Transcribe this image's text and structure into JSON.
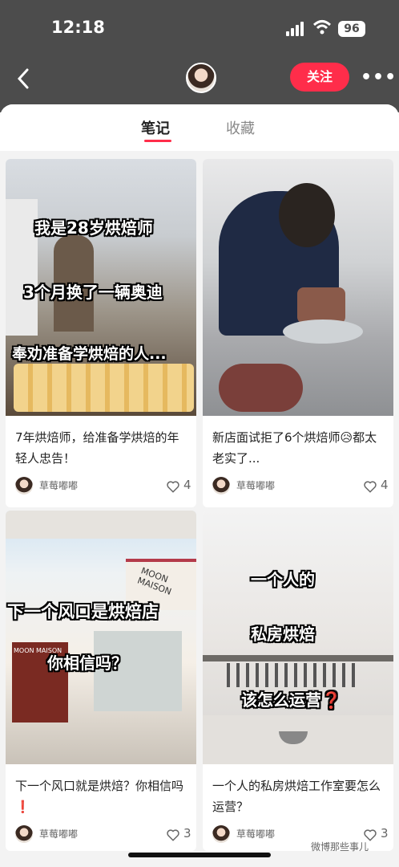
{
  "status_bar": {
    "time": "12:18",
    "battery": "96"
  },
  "header": {
    "follow_label": "关注",
    "more_label": "•••"
  },
  "tabs": [
    {
      "label": "笔记",
      "active": true
    },
    {
      "label": "收藏",
      "active": false
    }
  ],
  "cards": [
    {
      "title": "7年烘焙师，给准备学烘焙的年轻人忠告！",
      "author": "草莓嘟嘟",
      "likes": "4",
      "overlay": [
        "我是28岁烘焙师",
        "3个月换了一辆奥迪",
        "奉劝准备学烘焙的人..."
      ]
    },
    {
      "title": "新店面试拒了6个烘焙师😥都太老实了...",
      "author": "草莓嘟嘟",
      "likes": "4",
      "overlay": []
    },
    {
      "title": "下一个风口就是烘焙？你相信吗❗️",
      "author": "草莓嘟嘟",
      "likes": "3",
      "overlay": [
        "下一个风口是烘焙店",
        "你相信吗？"
      ],
      "sign1": "MOON MAISON",
      "sign2": "MOON MAISON"
    },
    {
      "title": "一个人的私房烘焙工作室要怎么运营？",
      "author": "草莓嘟嘟",
      "likes": "3",
      "overlay": [
        "一个人的",
        "私房烘焙",
        "该怎么运营❓"
      ]
    }
  ],
  "watermark": "微博那些事儿",
  "colors": {
    "accent": "#ff2d4a",
    "header_bg": "#4c4c4c"
  }
}
